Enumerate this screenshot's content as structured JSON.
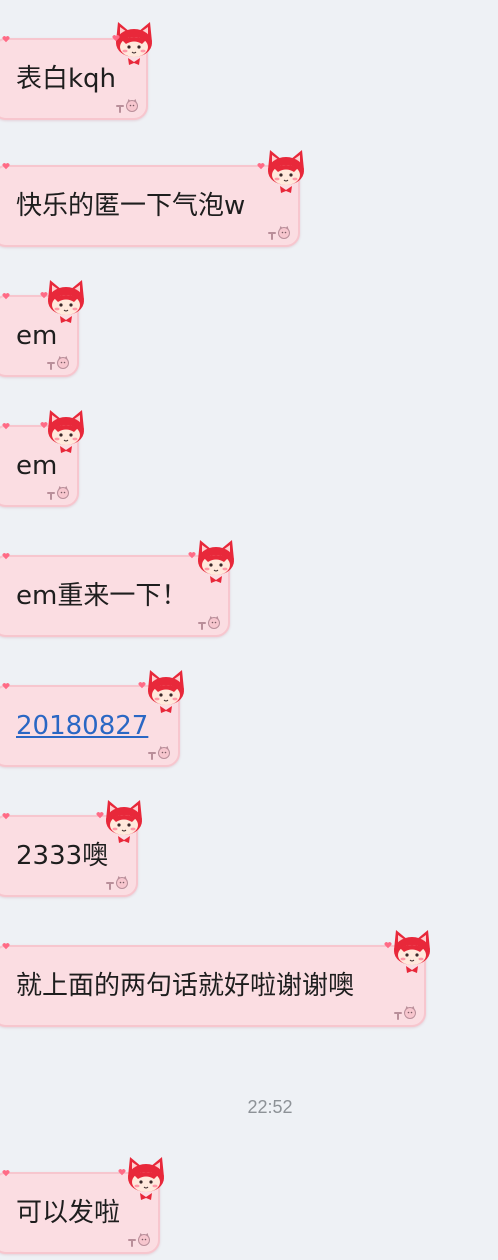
{
  "chat": {
    "messages": [
      {
        "text": "表白kqh",
        "is_link": false
      },
      {
        "text": "快乐的匿一下气泡w",
        "is_link": false
      },
      {
        "text": "em",
        "is_link": false
      },
      {
        "text": "em",
        "is_link": false
      },
      {
        "text": "em重来一下！",
        "is_link": false
      },
      {
        "text": "20180827",
        "is_link": true
      },
      {
        "text": "2333噢",
        "is_link": false
      },
      {
        "text": "就上面的两句话就好啦谢谢噢",
        "is_link": false
      },
      {
        "text": "可以发啦",
        "is_link": false
      }
    ],
    "timestamp": "22:52"
  },
  "colors": {
    "background": "#eef1f5",
    "bubble_fill": "#fbdde2",
    "bubble_border": "#f7c6ce",
    "link": "#2a67c4",
    "timestamp": "#8d9297",
    "fox_red": "#e8283a"
  },
  "icons": {
    "bubble_decoration": "fox-sticker-icon",
    "bubble_corner": "paw-cat-icon",
    "heart": "heart-icon"
  }
}
